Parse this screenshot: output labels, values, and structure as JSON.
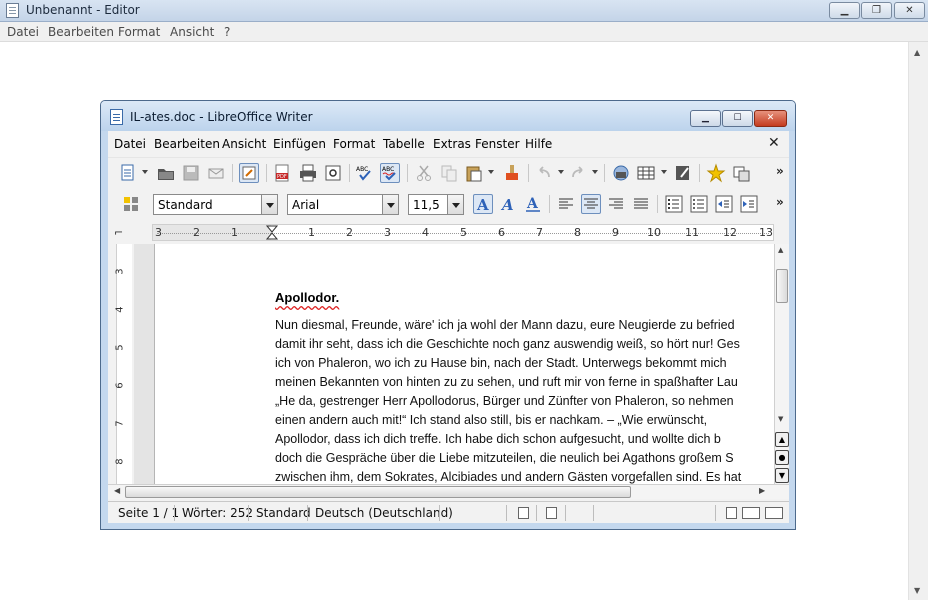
{
  "notepad": {
    "title": "Unbenannt - Editor",
    "menu": [
      "Datei",
      "Bearbeiten",
      "Format",
      "Ansicht",
      "?"
    ]
  },
  "writer": {
    "title": "IL-ates.doc - LibreOffice Writer",
    "menu": [
      "Datei",
      "Bearbeiten",
      "Ansicht",
      "Einfügen",
      "Format",
      "Tabelle",
      "Extras",
      "Fenster",
      "Hilfe"
    ],
    "toolbar": {
      "paragraph_style": "Standard",
      "font_name": "Arial",
      "font_size": "11,5"
    },
    "ruler_ticks": [
      "3",
      "2",
      "1",
      "1",
      "2",
      "3",
      "4",
      "5",
      "6",
      "7",
      "8",
      "9",
      "10",
      "11",
      "12",
      "13"
    ],
    "vruler_ticks": [
      "3",
      "4",
      "5",
      "6",
      "7",
      "8"
    ],
    "document": {
      "heading": "Apollodor.",
      "lines": [
        "Nun diesmal, Freunde, wäre' ich ja wohl der Mann dazu, eure Neugierde zu befried",
        "damit ihr seht, dass ich die Geschichte noch ganz auswendig weiß, so hört nur! Ges",
        "ich von Phaleron, wo ich zu Hause bin, nach der Stadt. Unterwegs bekommt mich",
        "meinen Bekannten von hinten zu zu sehen, und ruft mir von ferne in spaßhafter Lau",
        "„He da, gestrenger Herr Apollodorus, Bürger und Zünfter von Phaleron, so nehmen",
        "einen andern auch mit!“ Ich stand also still, bis er nachkam. – „Wie erwünscht,",
        "Apollodor, dass ich dich treffe. Ich habe dich schon aufgesucht, und wollte dich b",
        "doch die Gespräche über die Liebe mitzuteilen, die neulich bei Agathons großem S",
        "zwischen ihm, dem Sokrates, Alcibiades und andern Gästen vorgefallen sind. Es hat"
      ]
    },
    "statusbar": {
      "page": "Seite 1 / 1",
      "words": "Wörter: 252",
      "page_style": "Standard",
      "language": "Deutsch (Deutschland)"
    }
  }
}
